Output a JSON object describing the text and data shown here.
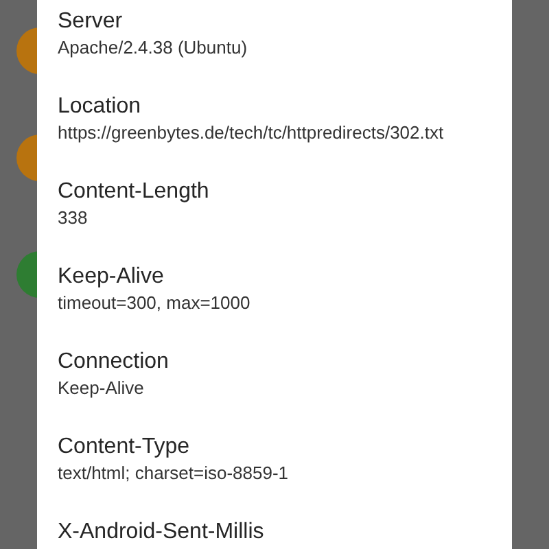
{
  "background_list": [
    {
      "color": "#b8730f"
    },
    {
      "color": "#b8730f"
    },
    {
      "color": "#2e7d32"
    }
  ],
  "dialog": {
    "headers": [
      {
        "name": "Server",
        "value": "Apache/2.4.38 (Ubuntu)"
      },
      {
        "name": "Location",
        "value": "https://greenbytes.de/tech/tc/httpredirects/302.txt"
      },
      {
        "name": "Content-Length",
        "value": "338"
      },
      {
        "name": "Keep-Alive",
        "value": "timeout=300, max=1000"
      },
      {
        "name": "Connection",
        "value": "Keep-Alive"
      },
      {
        "name": "Content-Type",
        "value": "text/html; charset=iso-8859-1"
      },
      {
        "name": "X-Android-Sent-Millis"
      }
    ]
  }
}
